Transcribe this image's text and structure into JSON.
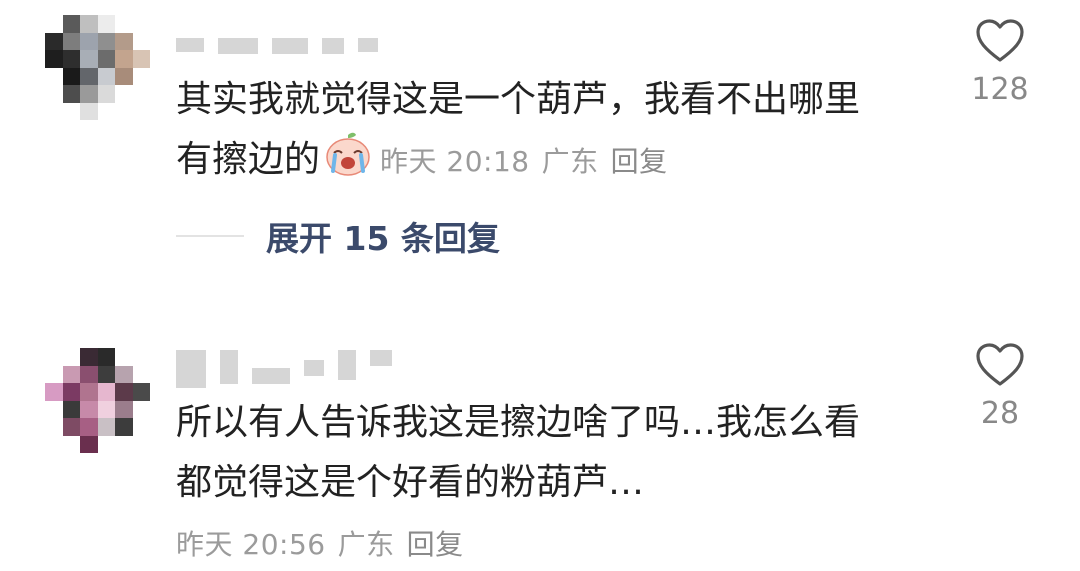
{
  "comments": [
    {
      "text_lines": [
        "其实我就觉得这是一个葫芦，我看不出哪里",
        "有擦边的"
      ],
      "emoji": "crying-emoji-icon",
      "time": "昨天 20:18",
      "location": "广东",
      "reply_label": "回复",
      "likes": "128",
      "expand_label": "展开 15 条回复"
    },
    {
      "text_lines": [
        "所以有人告诉我这是擦边啥了吗…我怎么看",
        "都觉得这是个好看的粉葫芦…"
      ],
      "time": "昨天 20:56",
      "location": "广东",
      "reply_label": "回复",
      "likes": "28"
    }
  ],
  "colors": {
    "text": "#222222",
    "meta": "#9b9b9b",
    "expand_link": "#3b4a6b",
    "heart_outline": "#555555"
  }
}
